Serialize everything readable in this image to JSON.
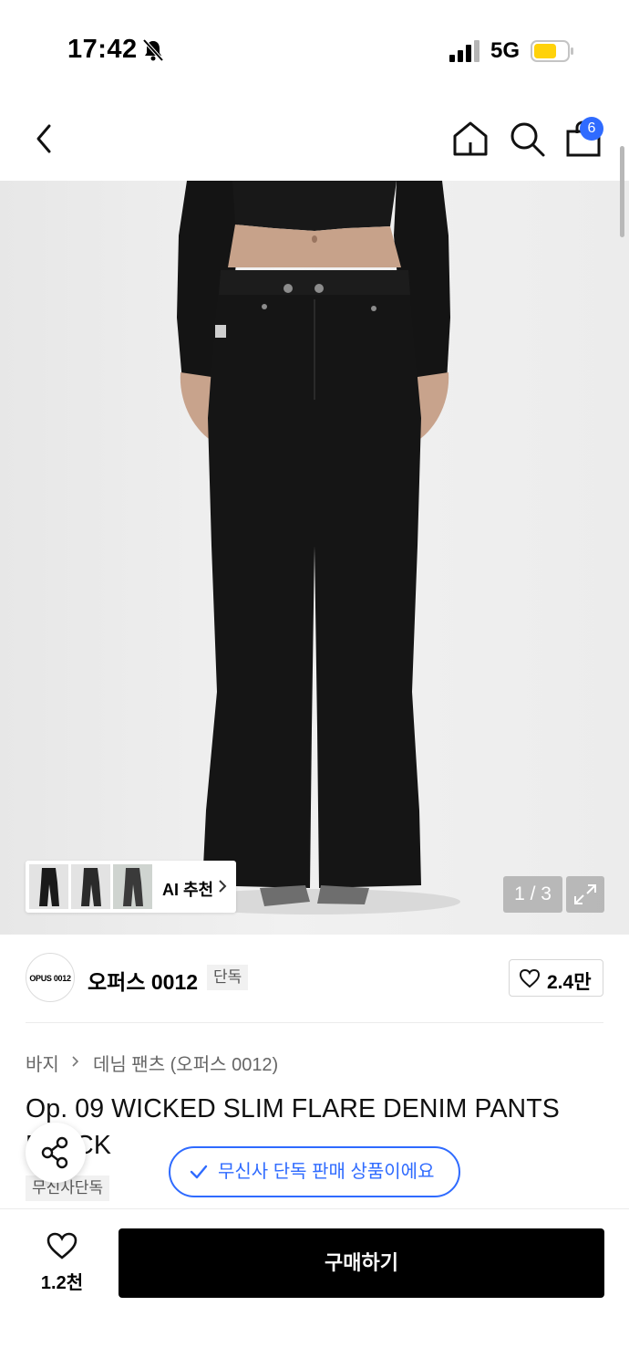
{
  "status_bar": {
    "time": "17:42",
    "network": "5G"
  },
  "nav": {
    "cart_count": "6"
  },
  "gallery": {
    "ai_label": "AI 추천",
    "page_counter": "1 / 3"
  },
  "brand": {
    "logo_text": "OPUS 0012",
    "name": "오퍼스 0012",
    "tag": "단독",
    "like_count": "2.4만"
  },
  "breadcrumb": {
    "category": "바지",
    "subcategory": "데님 팬츠 (오퍼스 0012)"
  },
  "product": {
    "title": "Op. 09 WICKED SLIM FLARE DENIM PANTS BLACK",
    "exclusive_tag": "무신사단독"
  },
  "banner": {
    "exclusive_text": "무신사 단독 판매 상품이에요"
  },
  "bottom": {
    "wish_count": "1.2천",
    "buy_label": "구매하기"
  },
  "colors": {
    "accent": "#2f6bff",
    "buy_button": "#000000",
    "battery": "#ffd20a"
  },
  "icons": [
    "bell-slash-icon",
    "signal-icon",
    "battery-icon",
    "back-icon",
    "home-icon",
    "search-icon",
    "cart-icon",
    "chevron-right-icon",
    "expand-icon",
    "heart-icon",
    "share-icon",
    "check-icon"
  ]
}
